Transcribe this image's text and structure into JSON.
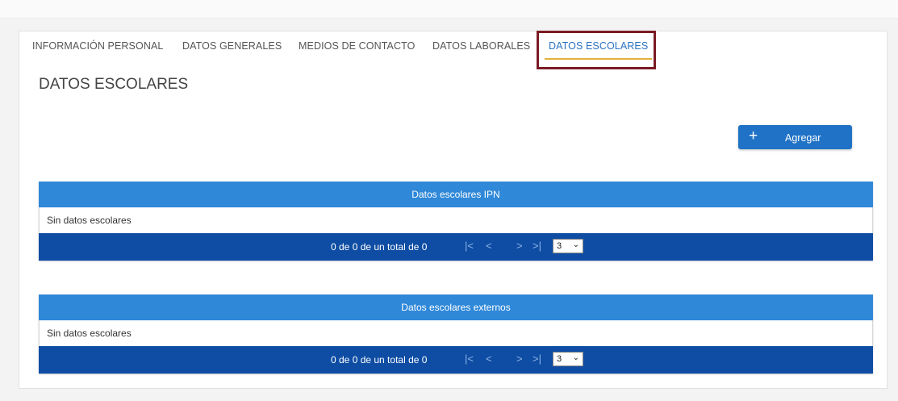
{
  "tabs": [
    {
      "label": "INFORMACIÓN PERSONAL"
    },
    {
      "label": "DATOS GENERALES"
    },
    {
      "label": "MEDIOS DE CONTACTO"
    },
    {
      "label": "DATOS LABORALES"
    },
    {
      "label": "DATOS ESCOLARES",
      "active": true
    }
  ],
  "section": {
    "title": "DATOS ESCOLARES"
  },
  "add_button": {
    "icon": "plus-icon",
    "label": "Agregar"
  },
  "tables": [
    {
      "header": "Datos escolares IPN",
      "empty_message": "Sin datos escolares",
      "pagination": {
        "summary": "0 de 0 de un total de 0",
        "first": "|<",
        "prev": "<",
        "next": ">",
        "last": ">|",
        "page_size": "3"
      }
    },
    {
      "header": "Datos escolares externos",
      "empty_message": "Sin datos escolares",
      "pagination": {
        "summary": "0 de 0 de un total de 0",
        "first": "|<",
        "prev": "<",
        "next": ">",
        "last": ">|",
        "page_size": "3"
      }
    }
  ],
  "colors": {
    "table_header": "#2f88d8",
    "table_footer": "#0e4da3",
    "active_tab": "#2a73c2",
    "tab_underline": "#e2b13a",
    "highlight_box": "#7a1b24",
    "button": "#1f72c6"
  }
}
